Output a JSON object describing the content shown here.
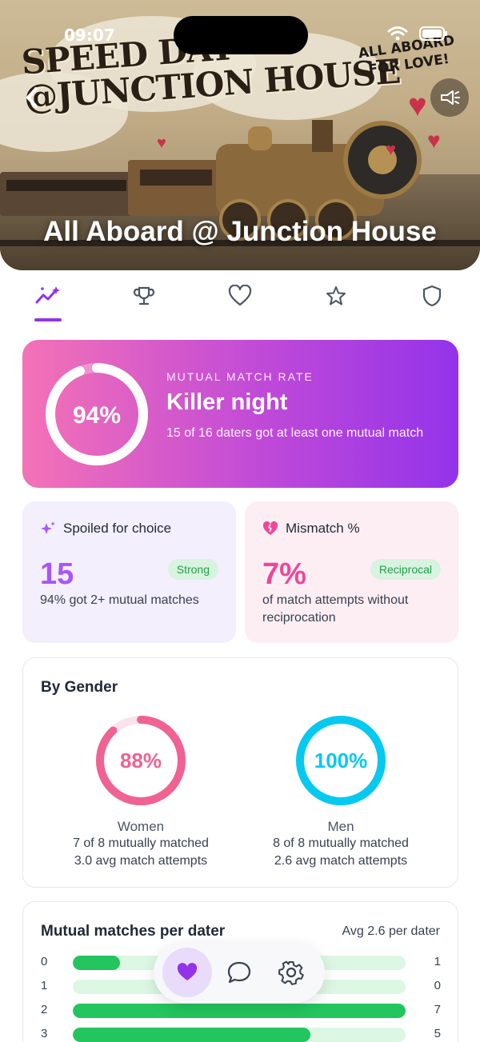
{
  "status": {
    "time": "09:07"
  },
  "hero": {
    "art_title_line1": "SPEED DAT",
    "art_title_line2": "@JUNCTION HOUSE",
    "art_tag_line1": "ALL ABOARD",
    "art_tag_line2": "FOR LOVE!",
    "title": "All Aboard @ Junction House"
  },
  "tabs": [
    {
      "icon": "trend-sparkle-icon",
      "active": true
    },
    {
      "icon": "trophy-icon",
      "active": false
    },
    {
      "icon": "heart-icon",
      "active": false
    },
    {
      "icon": "star-icon",
      "active": false
    },
    {
      "icon": "shield-icon",
      "active": false
    }
  ],
  "match_rate": {
    "percent_label": "94%",
    "percent": 94,
    "kicker": "MUTUAL MATCH RATE",
    "headline": "Killer night",
    "subtext": "15 of 16 daters got at least one mutual match"
  },
  "spoiled": {
    "title": "Spoiled for choice",
    "value": "15",
    "badge": "Strong",
    "description": "94% got 2+ mutual matches"
  },
  "mismatch": {
    "title": "Mismatch %",
    "value": "7%",
    "badge": "Reciprocal",
    "description": "of match attempts without reciprocation"
  },
  "by_gender": {
    "title": "By Gender",
    "women": {
      "percent_label": "88%",
      "percent": 88,
      "label": "Women",
      "line1": "7 of 8 mutually matched",
      "line2": "3.0 avg match attempts"
    },
    "men": {
      "percent_label": "100%",
      "percent": 100,
      "label": "Men",
      "line1": "8 of 8 mutually matched",
      "line2": "2.6 avg match attempts"
    }
  },
  "mutual_matches": {
    "title": "Mutual matches per dater",
    "avg": "Avg 2.6 per dater",
    "rows": [
      {
        "key": "0",
        "value": "1",
        "count": 1
      },
      {
        "key": "1",
        "value": "0",
        "count": 0
      },
      {
        "key": "2",
        "value": "7",
        "count": 7
      },
      {
        "key": "3",
        "value": "5",
        "count": 5
      }
    ]
  },
  "colors": {
    "accent": "#9333ea",
    "pink": "#ec4899",
    "women": "#f06292",
    "men": "#06c9f0",
    "bar": "#22c55e"
  },
  "dock": {
    "items": [
      "heart-icon",
      "chat-bubble-icon",
      "gear-icon"
    ]
  }
}
